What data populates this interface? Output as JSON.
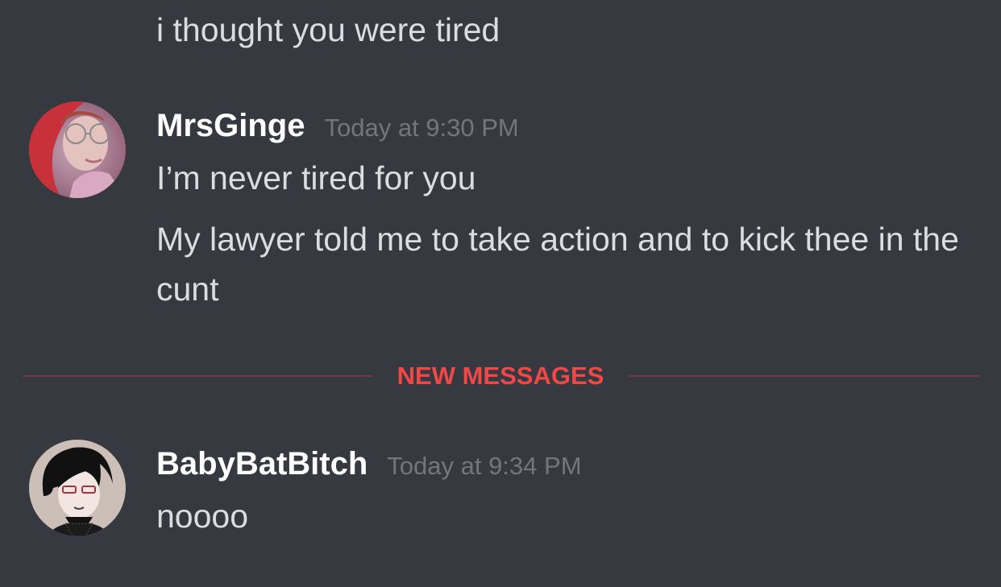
{
  "previous_message": {
    "text": "i thought you were tired"
  },
  "messages": [
    {
      "username": "MrsGinge",
      "timestamp": "Today at 9:30 PM",
      "lines": [
        "I’m never tired for you",
        "My lawyer told me to take action and to kick thee in the cunt"
      ]
    },
    {
      "username": "BabyBatBitch",
      "timestamp": "Today at 9:34 PM",
      "lines": [
        "noooo"
      ]
    }
  ],
  "divider": {
    "label": "NEW MESSAGES"
  },
  "colors": {
    "background": "#36393f",
    "username": "#ffffff",
    "timestamp": "#72767d",
    "message_text": "#dcddde",
    "new_messages_accent": "#f04747"
  }
}
